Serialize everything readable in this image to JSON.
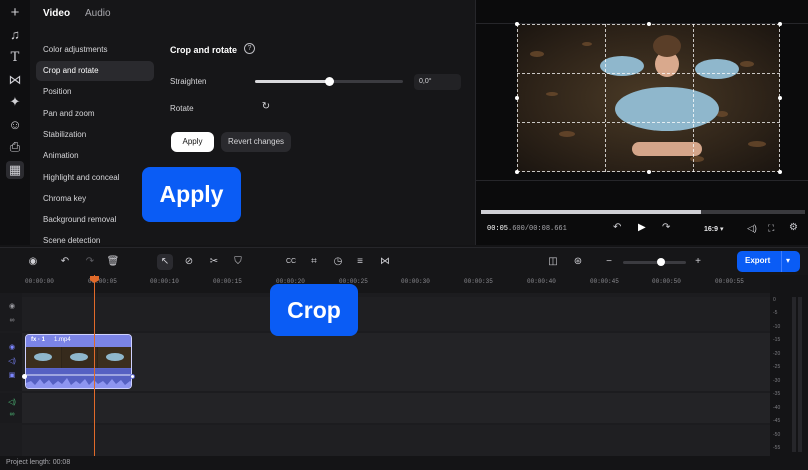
{
  "panel": {
    "tabs": [
      {
        "label": "Video"
      },
      {
        "label": "Audio"
      }
    ],
    "categories": [
      {
        "label": "Color adjustments"
      },
      {
        "label": "Crop and rotate"
      },
      {
        "label": "Position"
      },
      {
        "label": "Pan and zoom"
      },
      {
        "label": "Stabilization"
      },
      {
        "label": "Animation"
      },
      {
        "label": "Highlight and conceal"
      },
      {
        "label": "Chroma key"
      },
      {
        "label": "Background removal"
      },
      {
        "label": "Scene detection"
      }
    ],
    "section_title": "Crop and rotate",
    "straighten_label": "Straighten",
    "straighten_value": "0,0°",
    "straighten_fraction": 0.5,
    "rotate_label": "Rotate",
    "apply_label": "Apply",
    "revert_label": "Revert changes"
  },
  "preview": {
    "current_time_main": "00:05",
    "current_time_ms": ".600",
    "total_time": "/00:08.661",
    "playback_fraction": 0.68,
    "aspect": "16:9"
  },
  "toolbar": {
    "export_label": "Export"
  },
  "ruler": {
    "ticks": [
      "00:00:00",
      "00:00:05",
      "00:00:10",
      "00:00:15",
      "00:00:20",
      "00:00:25",
      "00:00:30",
      "00:00:35",
      "00:00:40",
      "00:00:45",
      "00:00:50",
      "00:00:55"
    ]
  },
  "clip": {
    "fx_label": "fx · 1",
    "name": "1.mp4"
  },
  "meter": {
    "labels": [
      "0",
      "-5",
      "-10",
      "-15",
      "-20",
      "-25",
      "-30",
      "-35",
      "-40",
      "-45",
      "-50",
      "-55"
    ]
  },
  "status": {
    "project_length": "Project length: 00:08"
  },
  "callouts": {
    "apply": "Apply",
    "crop": "Crop"
  },
  "colors": {
    "accent": "#0a5cf5",
    "clip": "#6a73d8",
    "playhead": "#e06a2a"
  }
}
